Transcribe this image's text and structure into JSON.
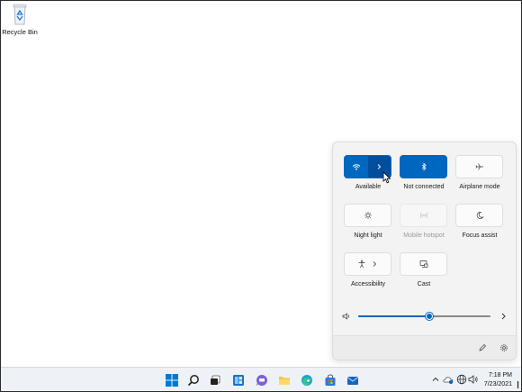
{
  "desktop": {
    "icons": [
      {
        "label": "Recycle Bin",
        "icon": "recycle-bin-icon"
      }
    ]
  },
  "quick_settings": {
    "tiles": [
      {
        "id": "wifi",
        "label": "Available",
        "icon": "wifi-icon",
        "state": "on",
        "has_chevron": true
      },
      {
        "id": "bluetooth",
        "label": "Not connected",
        "icon": "bluetooth-icon",
        "state": "on"
      },
      {
        "id": "airplane",
        "label": "Airplane mode",
        "icon": "airplane-icon",
        "state": "off"
      },
      {
        "id": "night-light",
        "label": "Night light",
        "icon": "brightness-icon",
        "state": "off"
      },
      {
        "id": "mobile-hotspot",
        "label": "Mobile hotspot",
        "icon": "hotspot-icon",
        "state": "disabled"
      },
      {
        "id": "focus-assist",
        "label": "Focus assist",
        "icon": "moon-icon",
        "state": "off"
      },
      {
        "id": "accessibility",
        "label": "Accessibility",
        "icon": "accessibility-icon",
        "state": "off",
        "has_chevron": true
      },
      {
        "id": "cast",
        "label": "Cast",
        "icon": "cast-icon",
        "state": "off"
      }
    ],
    "volume": {
      "level": 0.54,
      "icon": "speaker-icon",
      "more_icon": "chevron-right-icon"
    },
    "footer": {
      "edit_icon": "pencil-icon",
      "settings_icon": "gear-icon"
    }
  },
  "taskbar": {
    "apps": [
      "windows-start-icon",
      "search-icon",
      "task-view-icon",
      "widgets-icon",
      "chat-icon",
      "file-explorer-icon",
      "edge-icon",
      "store-icon",
      "mail-icon"
    ],
    "tray": {
      "icons": [
        "chevron-up-icon",
        "onedrive-icon",
        "network-icon",
        "volume-icon"
      ],
      "time": "7:18 PM",
      "date": "7/23/2021"
    }
  },
  "colors": {
    "accent": "#0067c0",
    "accent_dark": "#004e9c",
    "flyout_bg": "#f3f3f3",
    "taskbar_bg": "#eef1f6"
  }
}
